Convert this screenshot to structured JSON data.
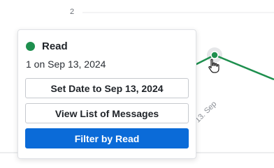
{
  "chart": {
    "y_tick_label": "2",
    "x_tick_label": "13. Sep",
    "series_color": "#1e8f4e"
  },
  "popover": {
    "series_name": "Read",
    "series_color": "#1e8f4e",
    "subtitle": "1 on Sep 13, 2024",
    "buttons": {
      "set_date": "Set Date to Sep 13, 2024",
      "view_list": "View List of Messages",
      "filter": "Filter by Read"
    },
    "primary_color": "#0b6bd8"
  }
}
